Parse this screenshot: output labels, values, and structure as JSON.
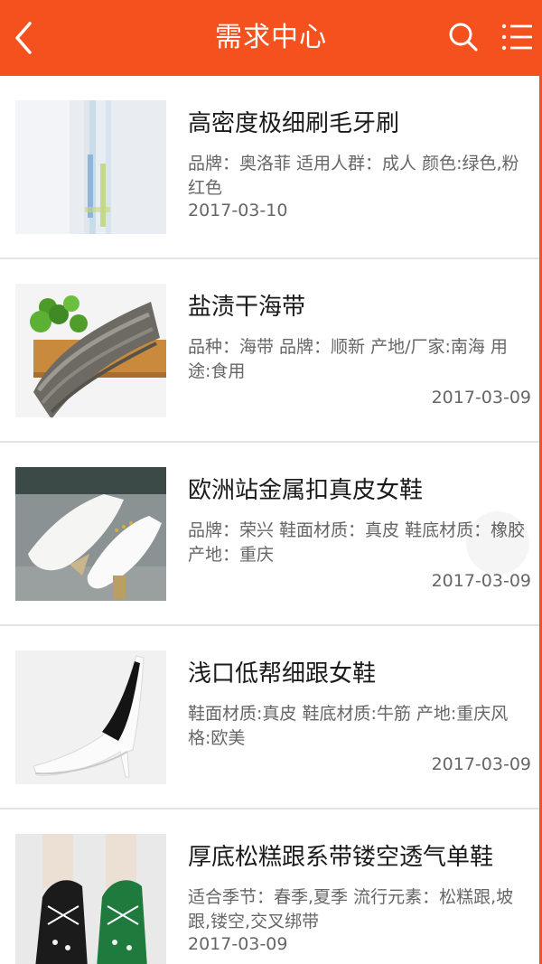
{
  "header": {
    "title": "需求中心",
    "icons": {
      "back": "chevron-left-icon",
      "search": "search-icon",
      "menu": "list-menu-icon"
    },
    "background": "#f4511e"
  },
  "items": [
    {
      "title": "高密度极细刷毛牙刷",
      "attrs": "品牌：奥洛菲 适用人群：成人 颜色:绿色,粉红色",
      "date": "2017-03-10",
      "date_align": "left",
      "image": "toothbrush-photo"
    },
    {
      "title": "盐渍干海带",
      "attrs": "品种：海带 品牌：顺新 产地/厂家:南海 用途:食用",
      "date": "2017-03-09",
      "date_align": "right",
      "image": "dried-kelp-photo"
    },
    {
      "title": "欧洲站金属扣真皮女鞋",
      "attrs": "品牌：荣兴 鞋面材质：真皮 鞋底材质：橡胶 产地：重庆",
      "date": "2017-03-09",
      "date_align": "right",
      "image": "leather-shoes-photo"
    },
    {
      "title": "浅口低帮细跟女鞋",
      "attrs": "鞋面材质:真皮 鞋底材质:牛筋 产地:重庆风格:欧美",
      "date": "2017-03-09",
      "date_align": "right",
      "image": "white-heel-photo"
    },
    {
      "title": "厚底松糕跟系带镂空透气单鞋",
      "attrs": "适合季节：春季,夏季 流行元素：松糕跟,坡跟,镂空,交叉绑带",
      "date": "2017-03-09",
      "date_align": "left",
      "image": "platform-shoes-photo"
    }
  ]
}
